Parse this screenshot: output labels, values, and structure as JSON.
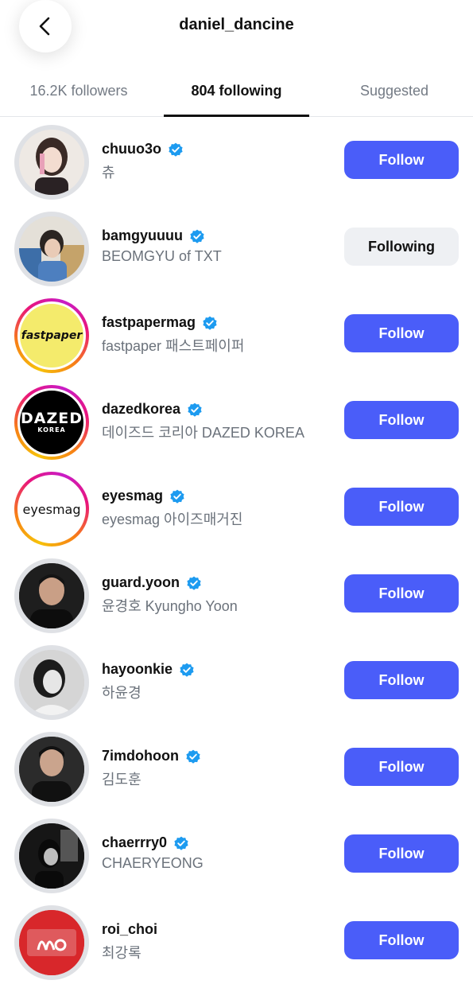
{
  "header": {
    "title": "daniel_dancine",
    "back_icon": "chevron-left-icon"
  },
  "tabs": [
    {
      "label": "16.2K followers",
      "active": false
    },
    {
      "label": "804 following",
      "active": true
    },
    {
      "label": "Suggested",
      "active": false
    }
  ],
  "accounts": [
    {
      "username": "chuuo3o",
      "fullname": "츄",
      "verified": true,
      "button": "Follow",
      "story_ring": false
    },
    {
      "username": "bamgyuuuu",
      "fullname": "BEOMGYU of TXT",
      "verified": true,
      "button": "Following",
      "story_ring": false
    },
    {
      "username": "fastpapermag",
      "fullname": "fastpaper 패스트페이퍼",
      "verified": true,
      "button": "Follow",
      "story_ring": true,
      "logo_text": "fastpaper"
    },
    {
      "username": "dazedkorea",
      "fullname": "데이즈드 코리아 DAZED KOREA",
      "verified": true,
      "button": "Follow",
      "story_ring": true,
      "logo_text": "DAZED",
      "logo_subtext": "KOREA"
    },
    {
      "username": "eyesmag",
      "fullname": "eyesmag 아이즈매거진",
      "verified": true,
      "button": "Follow",
      "story_ring": true,
      "logo_text": "eyesmag"
    },
    {
      "username": "guard.yoon",
      "fullname": "윤경호 Kyungho Yoon",
      "verified": true,
      "button": "Follow",
      "story_ring": false
    },
    {
      "username": "hayoonkie",
      "fullname": "하윤경",
      "verified": true,
      "button": "Follow",
      "story_ring": false
    },
    {
      "username": "7imdohoon",
      "fullname": "김도훈",
      "verified": true,
      "button": "Follow",
      "story_ring": false
    },
    {
      "username": "chaerrry0",
      "fullname": "CHAERYEONG",
      "verified": true,
      "button": "Follow",
      "story_ring": false
    },
    {
      "username": "roi_choi",
      "fullname": "최강록",
      "verified": false,
      "button": "Follow",
      "story_ring": false
    }
  ],
  "colors": {
    "follow_button": "#4a5df9",
    "following_button": "#eef0f3",
    "verified_badge": "#1d9bf0",
    "secondary_text": "#6b727b"
  }
}
